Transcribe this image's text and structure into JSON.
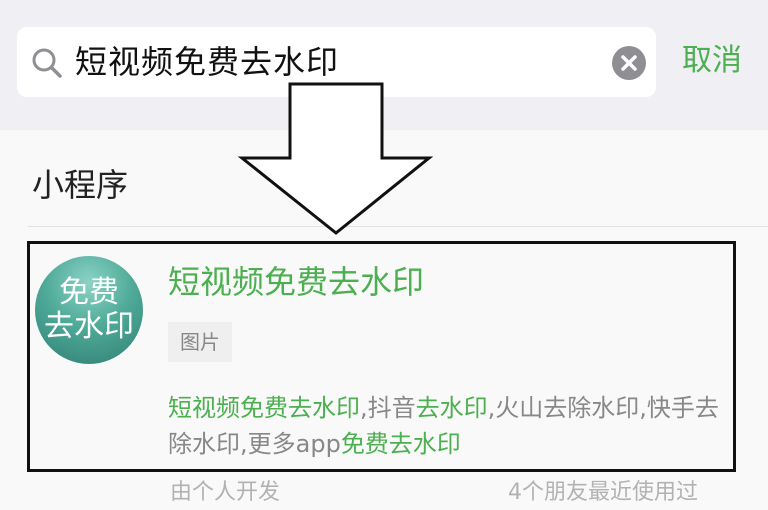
{
  "search": {
    "query": "短视频免费去水印",
    "cancel_label": "取消"
  },
  "section": {
    "title": "小程序"
  },
  "result": {
    "avatar_line1": "免费",
    "avatar_line2": "去水印",
    "title": "短视频免费去水印",
    "tag": "图片",
    "description": [
      {
        "text": "短视频免费去水印",
        "highlight": true
      },
      {
        "text": ",抖音",
        "highlight": false
      },
      {
        "text": "去水印",
        "highlight": true
      },
      {
        "text": ",火山去除水印,快手去除水印,更多app",
        "highlight": false
      },
      {
        "text": "免费去水印",
        "highlight": true
      }
    ],
    "developer": "由个人开发",
    "friends_used": "4个朋友最近使用过"
  },
  "colors": {
    "accent": "#4caf50",
    "muted": "#888888",
    "background": "#f9f9f9",
    "search_bar_bg": "#efeff4"
  },
  "icons": [
    "search-icon",
    "clear-icon",
    "down-arrow-icon"
  ]
}
